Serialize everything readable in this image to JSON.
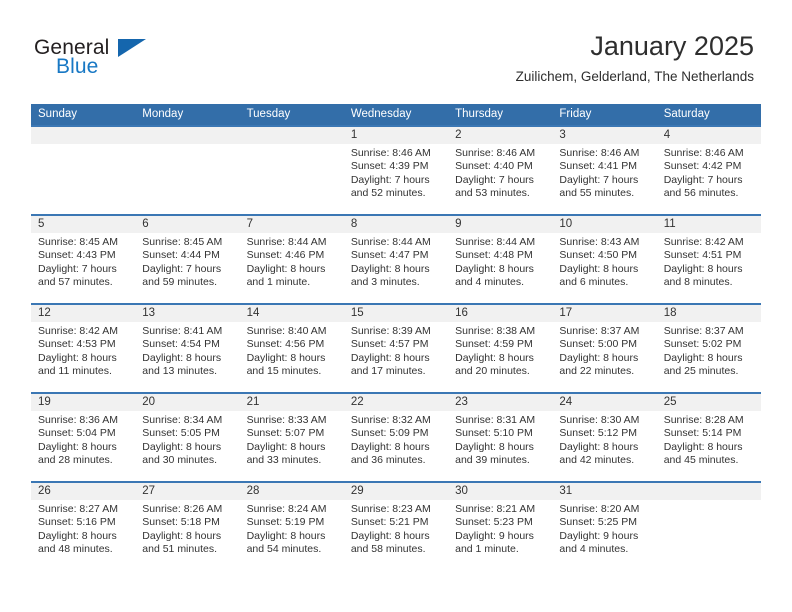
{
  "logo": {
    "word_top": "General",
    "word_bottom": "Blue",
    "accent_color": "#1878c4",
    "triangle_color": "#1566ad",
    "triangle_icon": "triangle-icon"
  },
  "header": {
    "title": "January 2025",
    "subtitle": "Zuilichem, Gelderland, The Netherlands"
  },
  "calendar": {
    "header_bg": "#336ea9",
    "row_divider_color": "#3b77b4",
    "day_band_bg": "#f1f1f1",
    "weekdays": [
      "Sunday",
      "Monday",
      "Tuesday",
      "Wednesday",
      "Thursday",
      "Friday",
      "Saturday"
    ],
    "weeks": [
      [
        {
          "day": "",
          "l1": "",
          "l2": "",
          "l3": "",
          "l4": ""
        },
        {
          "day": "",
          "l1": "",
          "l2": "",
          "l3": "",
          "l4": ""
        },
        {
          "day": "",
          "l1": "",
          "l2": "",
          "l3": "",
          "l4": ""
        },
        {
          "day": "1",
          "l1": "Sunrise: 8:46 AM",
          "l2": "Sunset: 4:39 PM",
          "l3": "Daylight: 7 hours",
          "l4": "and 52 minutes."
        },
        {
          "day": "2",
          "l1": "Sunrise: 8:46 AM",
          "l2": "Sunset: 4:40 PM",
          "l3": "Daylight: 7 hours",
          "l4": "and 53 minutes."
        },
        {
          "day": "3",
          "l1": "Sunrise: 8:46 AM",
          "l2": "Sunset: 4:41 PM",
          "l3": "Daylight: 7 hours",
          "l4": "and 55 minutes."
        },
        {
          "day": "4",
          "l1": "Sunrise: 8:46 AM",
          "l2": "Sunset: 4:42 PM",
          "l3": "Daylight: 7 hours",
          "l4": "and 56 minutes."
        }
      ],
      [
        {
          "day": "5",
          "l1": "Sunrise: 8:45 AM",
          "l2": "Sunset: 4:43 PM",
          "l3": "Daylight: 7 hours",
          "l4": "and 57 minutes."
        },
        {
          "day": "6",
          "l1": "Sunrise: 8:45 AM",
          "l2": "Sunset: 4:44 PM",
          "l3": "Daylight: 7 hours",
          "l4": "and 59 minutes."
        },
        {
          "day": "7",
          "l1": "Sunrise: 8:44 AM",
          "l2": "Sunset: 4:46 PM",
          "l3": "Daylight: 8 hours",
          "l4": "and 1 minute."
        },
        {
          "day": "8",
          "l1": "Sunrise: 8:44 AM",
          "l2": "Sunset: 4:47 PM",
          "l3": "Daylight: 8 hours",
          "l4": "and 3 minutes."
        },
        {
          "day": "9",
          "l1": "Sunrise: 8:44 AM",
          "l2": "Sunset: 4:48 PM",
          "l3": "Daylight: 8 hours",
          "l4": "and 4 minutes."
        },
        {
          "day": "10",
          "l1": "Sunrise: 8:43 AM",
          "l2": "Sunset: 4:50 PM",
          "l3": "Daylight: 8 hours",
          "l4": "and 6 minutes."
        },
        {
          "day": "11",
          "l1": "Sunrise: 8:42 AM",
          "l2": "Sunset: 4:51 PM",
          "l3": "Daylight: 8 hours",
          "l4": "and 8 minutes."
        }
      ],
      [
        {
          "day": "12",
          "l1": "Sunrise: 8:42 AM",
          "l2": "Sunset: 4:53 PM",
          "l3": "Daylight: 8 hours",
          "l4": "and 11 minutes."
        },
        {
          "day": "13",
          "l1": "Sunrise: 8:41 AM",
          "l2": "Sunset: 4:54 PM",
          "l3": "Daylight: 8 hours",
          "l4": "and 13 minutes."
        },
        {
          "day": "14",
          "l1": "Sunrise: 8:40 AM",
          "l2": "Sunset: 4:56 PM",
          "l3": "Daylight: 8 hours",
          "l4": "and 15 minutes."
        },
        {
          "day": "15",
          "l1": "Sunrise: 8:39 AM",
          "l2": "Sunset: 4:57 PM",
          "l3": "Daylight: 8 hours",
          "l4": "and 17 minutes."
        },
        {
          "day": "16",
          "l1": "Sunrise: 8:38 AM",
          "l2": "Sunset: 4:59 PM",
          "l3": "Daylight: 8 hours",
          "l4": "and 20 minutes."
        },
        {
          "day": "17",
          "l1": "Sunrise: 8:37 AM",
          "l2": "Sunset: 5:00 PM",
          "l3": "Daylight: 8 hours",
          "l4": "and 22 minutes."
        },
        {
          "day": "18",
          "l1": "Sunrise: 8:37 AM",
          "l2": "Sunset: 5:02 PM",
          "l3": "Daylight: 8 hours",
          "l4": "and 25 minutes."
        }
      ],
      [
        {
          "day": "19",
          "l1": "Sunrise: 8:36 AM",
          "l2": "Sunset: 5:04 PM",
          "l3": "Daylight: 8 hours",
          "l4": "and 28 minutes."
        },
        {
          "day": "20",
          "l1": "Sunrise: 8:34 AM",
          "l2": "Sunset: 5:05 PM",
          "l3": "Daylight: 8 hours",
          "l4": "and 30 minutes."
        },
        {
          "day": "21",
          "l1": "Sunrise: 8:33 AM",
          "l2": "Sunset: 5:07 PM",
          "l3": "Daylight: 8 hours",
          "l4": "and 33 minutes."
        },
        {
          "day": "22",
          "l1": "Sunrise: 8:32 AM",
          "l2": "Sunset: 5:09 PM",
          "l3": "Daylight: 8 hours",
          "l4": "and 36 minutes."
        },
        {
          "day": "23",
          "l1": "Sunrise: 8:31 AM",
          "l2": "Sunset: 5:10 PM",
          "l3": "Daylight: 8 hours",
          "l4": "and 39 minutes."
        },
        {
          "day": "24",
          "l1": "Sunrise: 8:30 AM",
          "l2": "Sunset: 5:12 PM",
          "l3": "Daylight: 8 hours",
          "l4": "and 42 minutes."
        },
        {
          "day": "25",
          "l1": "Sunrise: 8:28 AM",
          "l2": "Sunset: 5:14 PM",
          "l3": "Daylight: 8 hours",
          "l4": "and 45 minutes."
        }
      ],
      [
        {
          "day": "26",
          "l1": "Sunrise: 8:27 AM",
          "l2": "Sunset: 5:16 PM",
          "l3": "Daylight: 8 hours",
          "l4": "and 48 minutes."
        },
        {
          "day": "27",
          "l1": "Sunrise: 8:26 AM",
          "l2": "Sunset: 5:18 PM",
          "l3": "Daylight: 8 hours",
          "l4": "and 51 minutes."
        },
        {
          "day": "28",
          "l1": "Sunrise: 8:24 AM",
          "l2": "Sunset: 5:19 PM",
          "l3": "Daylight: 8 hours",
          "l4": "and 54 minutes."
        },
        {
          "day": "29",
          "l1": "Sunrise: 8:23 AM",
          "l2": "Sunset: 5:21 PM",
          "l3": "Daylight: 8 hours",
          "l4": "and 58 minutes."
        },
        {
          "day": "30",
          "l1": "Sunrise: 8:21 AM",
          "l2": "Sunset: 5:23 PM",
          "l3": "Daylight: 9 hours",
          "l4": "and 1 minute."
        },
        {
          "day": "31",
          "l1": "Sunrise: 8:20 AM",
          "l2": "Sunset: 5:25 PM",
          "l3": "Daylight: 9 hours",
          "l4": "and 4 minutes."
        },
        {
          "day": "",
          "l1": "",
          "l2": "",
          "l3": "",
          "l4": ""
        }
      ]
    ]
  }
}
